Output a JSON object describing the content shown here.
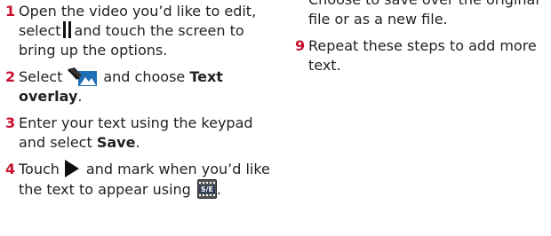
{
  "steps": {
    "s1": {
      "num": "1",
      "a": "Open the video you’d like to edit, select",
      "b": "and touch the screen to bring up the options."
    },
    "s2": {
      "num": "2",
      "a": "Select",
      "b": "and choose",
      "bold": "Text overlay",
      "c": "."
    },
    "s3": {
      "num": "3",
      "a": "Enter your text using the keypad and select",
      "bold": "Save",
      "c": "."
    },
    "s4": {
      "num": "4",
      "a": "Touch",
      "b": "and mark when you’d like the text to appear using",
      "c": "."
    },
    "s8_cont": "Choose to save over the original file or as a new file.",
    "s9": {
      "num": "9",
      "a": "Repeat these steps to add more text."
    }
  },
  "icons": {
    "pause": "pause-icon",
    "edit": "edit-video-icon",
    "play": "play-icon",
    "se": "start-end-icon",
    "se_label": "S/E"
  }
}
